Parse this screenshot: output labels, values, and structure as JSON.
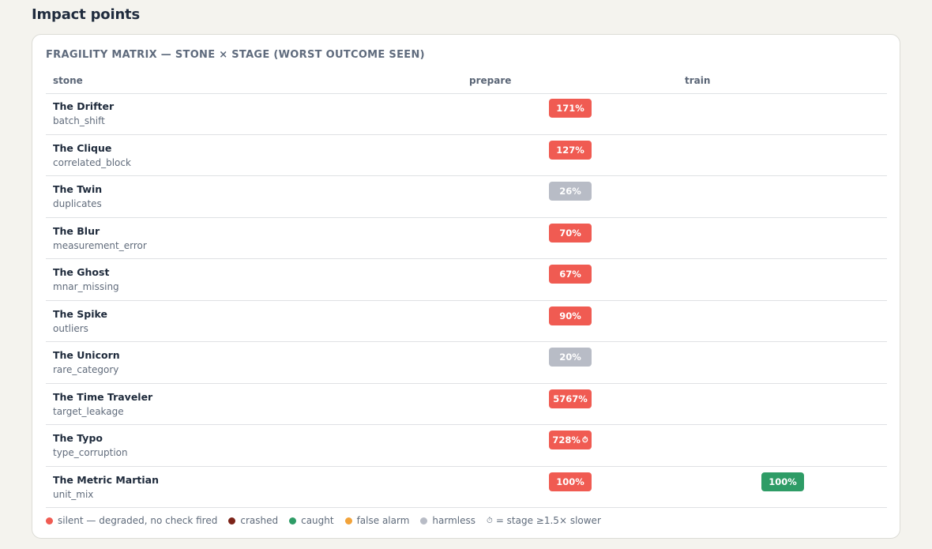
{
  "page": {
    "title": "Impact points"
  },
  "matrix": {
    "title": "FRAGILITY MATRIX — STONE × STAGE (WORST OUTCOME SEEN)",
    "columns": {
      "stone": "stone",
      "prepare": "prepare",
      "train": "train"
    },
    "rows": [
      {
        "name": "The Drifter",
        "id": "batch_shift",
        "prepare": {
          "value": "171%",
          "outcome": "silent",
          "slow": false
        },
        "train": null
      },
      {
        "name": "The Clique",
        "id": "correlated_block",
        "prepare": {
          "value": "127%",
          "outcome": "silent",
          "slow": false
        },
        "train": null
      },
      {
        "name": "The Twin",
        "id": "duplicates",
        "prepare": {
          "value": "26%",
          "outcome": "harmless",
          "slow": false
        },
        "train": null
      },
      {
        "name": "The Blur",
        "id": "measurement_error",
        "prepare": {
          "value": "70%",
          "outcome": "silent",
          "slow": false
        },
        "train": null
      },
      {
        "name": "The Ghost",
        "id": "mnar_missing",
        "prepare": {
          "value": "67%",
          "outcome": "silent",
          "slow": false
        },
        "train": null
      },
      {
        "name": "The Spike",
        "id": "outliers",
        "prepare": {
          "value": "90%",
          "outcome": "silent",
          "slow": false
        },
        "train": null
      },
      {
        "name": "The Unicorn",
        "id": "rare_category",
        "prepare": {
          "value": "20%",
          "outcome": "harmless",
          "slow": false
        },
        "train": null
      },
      {
        "name": "The Time Traveler",
        "id": "target_leakage",
        "prepare": {
          "value": "5767%",
          "outcome": "silent",
          "slow": false
        },
        "train": null
      },
      {
        "name": "The Typo",
        "id": "type_corruption",
        "prepare": {
          "value": "728%",
          "outcome": "silent",
          "slow": true
        },
        "train": null
      },
      {
        "name": "The Metric Martian",
        "id": "unit_mix",
        "prepare": {
          "value": "100%",
          "outcome": "silent",
          "slow": false
        },
        "train": {
          "value": "100%",
          "outcome": "caught",
          "slow": false
        }
      }
    ]
  },
  "legend": {
    "silent": "silent — degraded, no check fired",
    "crashed": "crashed",
    "caught": "caught",
    "false_alarm": "false alarm",
    "harmless": "harmless",
    "slow_note": "= stage ≥1.5× slower",
    "slow_icon": "⏱"
  },
  "colors": {
    "silent": "#f05b52",
    "crashed": "#7c2318",
    "caught": "#2e9c66",
    "false_alarm": "#f2a33a",
    "harmless": "#b8bcc6"
  }
}
